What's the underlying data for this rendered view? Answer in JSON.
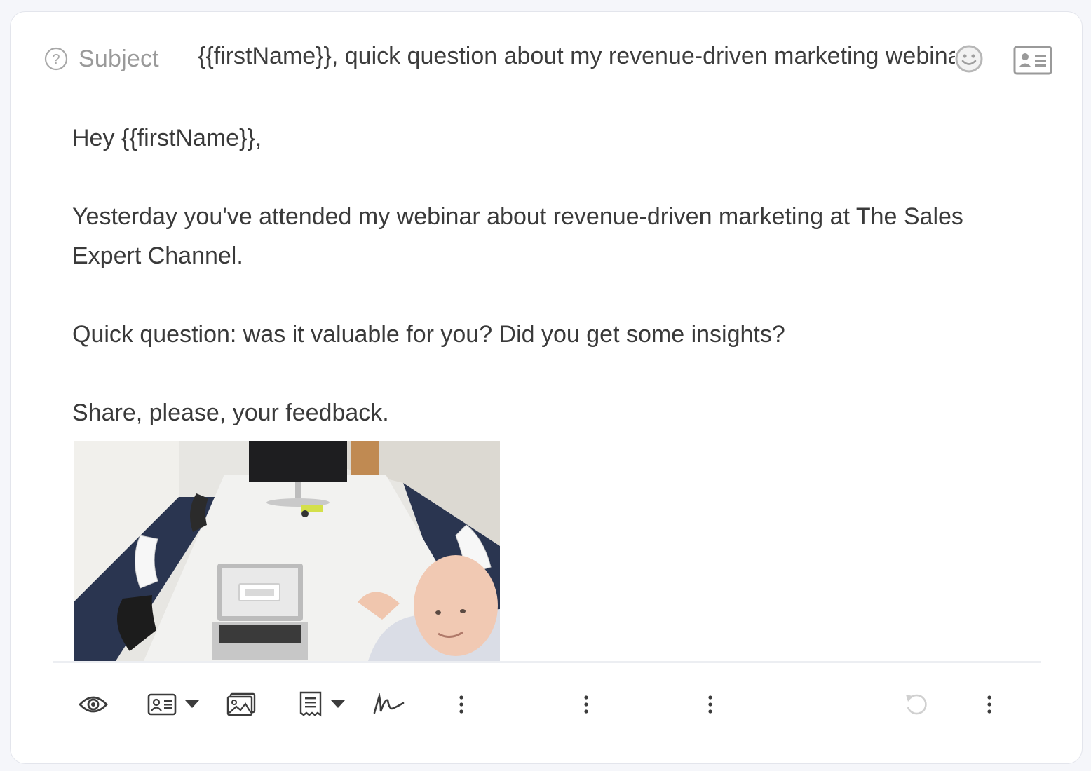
{
  "subject": {
    "label": "Subject",
    "value": "{{firstName}}, quick question about my revenue-driven marketing webinar"
  },
  "body": {
    "paragraphs": [
      "Hey {{firstName}},",
      "Yesterday you've attended my webinar about revenue-driven marketing at The Sales Expert Channel.",
      "Quick question: was it valuable for you? Did you get some insights?",
      "Share, please, your feedback."
    ]
  },
  "icons": {
    "help": "question-circle-icon",
    "emoji": "smiley-icon",
    "contact": "contact-card-icon",
    "preview": "eye-icon",
    "insert_variable": "contact-card-icon",
    "insert_image": "image-icon",
    "template": "document-icon",
    "signature": "signature-icon",
    "more": "vertical-ellipsis-icon",
    "undo": "undo-icon"
  },
  "colors": {
    "text": "#3a3a3a",
    "muted": "#9a9a9a",
    "icon": "#3c3c3c",
    "border": "#e3e5ec"
  }
}
